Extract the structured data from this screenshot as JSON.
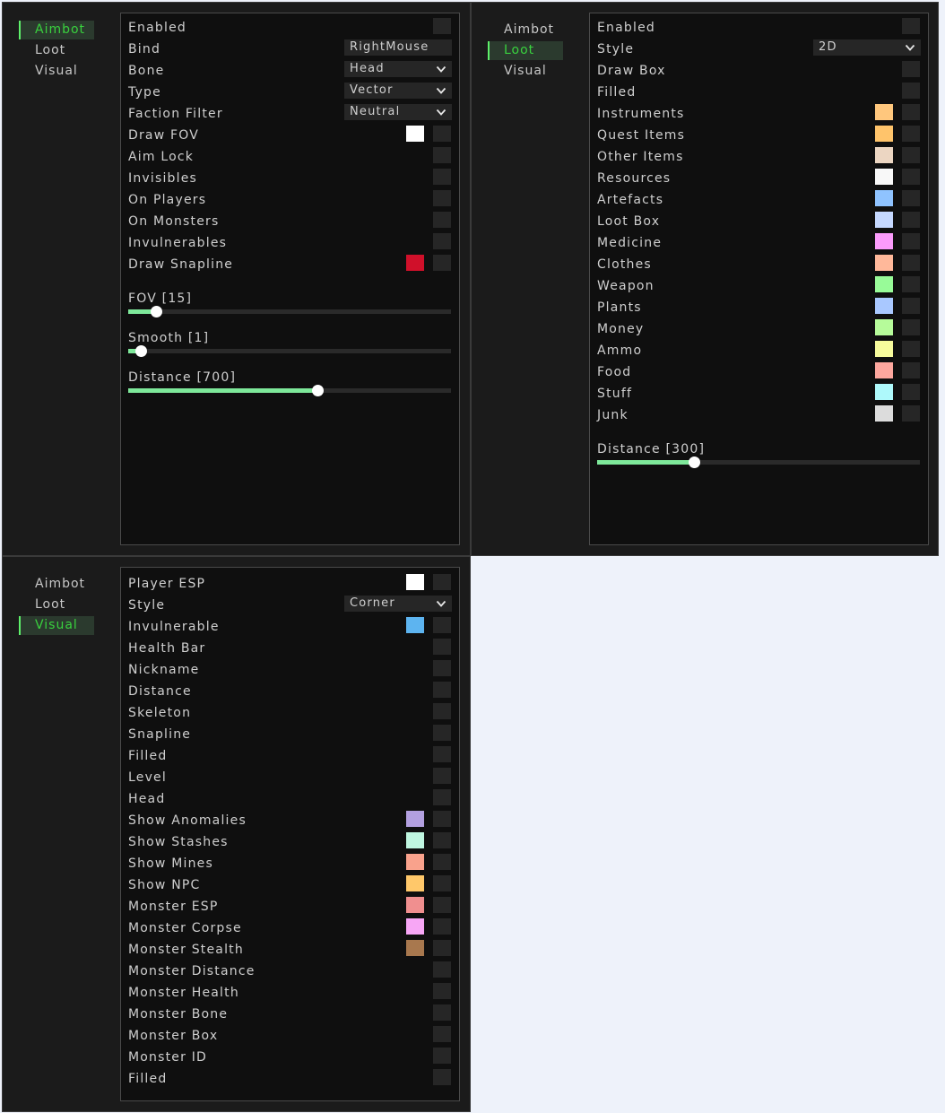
{
  "nav": [
    "Aimbot",
    "Loot",
    "Visual"
  ],
  "windows": [
    {
      "active": 0,
      "rows": [
        {
          "label": "Enabled",
          "checkbox": true
        },
        {
          "label": "Bind",
          "field": "RightMouse"
        },
        {
          "label": "Bone",
          "dropdown": "Head"
        },
        {
          "label": "Type",
          "dropdown": "Vector"
        },
        {
          "label": "Faction Filter",
          "dropdown": "Neutral"
        },
        {
          "label": "Draw FOV",
          "color": "#ffffff",
          "checkbox": true
        },
        {
          "label": "Aim Lock",
          "checkbox": true
        },
        {
          "label": "Invisibles",
          "checkbox": true
        },
        {
          "label": "On Players",
          "checkbox": true
        },
        {
          "label": "On Monsters",
          "checkbox": true
        },
        {
          "label": "Invulnerables",
          "checkbox": true
        },
        {
          "label": "Draw Snapline",
          "color": "#d0102a",
          "checkbox": true
        }
      ],
      "sliders": [
        {
          "label": "FOV [15]",
          "fraction": 0.085
        },
        {
          "label": "Smooth [1]",
          "fraction": 0.04
        },
        {
          "label": "Distance [700]",
          "fraction": 0.585
        }
      ]
    },
    {
      "active": 1,
      "rows": [
        {
          "label": "Enabled",
          "checkbox": true
        },
        {
          "label": "Style",
          "dropdown": "2D"
        },
        {
          "label": "Draw Box",
          "checkbox": true
        },
        {
          "label": "Filled",
          "checkbox": true
        },
        {
          "label": "Instruments",
          "color": "#ffc77d",
          "checkbox": true
        },
        {
          "label": "Quest Items",
          "color": "#ffc46b",
          "checkbox": true
        },
        {
          "label": "Other Items",
          "color": "#ecd6c2",
          "checkbox": true
        },
        {
          "label": "Resources",
          "color": "#f8f8f8",
          "checkbox": true
        },
        {
          "label": "Artefacts",
          "color": "#8fc3ff",
          "checkbox": true
        },
        {
          "label": "Loot Box",
          "color": "#c5d8ff",
          "checkbox": true
        },
        {
          "label": "Medicine",
          "color": "#fb9bfb",
          "checkbox": true
        },
        {
          "label": "Clothes",
          "color": "#ffb89a",
          "checkbox": true
        },
        {
          "label": "Weapon",
          "color": "#98fb98",
          "checkbox": true
        },
        {
          "label": "Plants",
          "color": "#a9c8ff",
          "checkbox": true
        },
        {
          "label": "Money",
          "color": "#b6fb9a",
          "checkbox": true
        },
        {
          "label": "Ammo",
          "color": "#f7fb9c",
          "checkbox": true
        },
        {
          "label": "Food",
          "color": "#fda79e",
          "checkbox": true
        },
        {
          "label": "Stuff",
          "color": "#aef9fb",
          "checkbox": true
        },
        {
          "label": "Junk",
          "color": "#dcdcdc",
          "checkbox": true
        }
      ],
      "sliders": [
        {
          "label": "Distance [300]",
          "fraction": 0.3
        }
      ]
    },
    {
      "active": 2,
      "rows": [
        {
          "label": "Player ESP",
          "color": "#ffffff",
          "checkbox": true
        },
        {
          "label": "Style",
          "dropdown": "Corner"
        },
        {
          "label": "Invulnerable",
          "color": "#5db4f0",
          "checkbox": true
        },
        {
          "label": "Health Bar",
          "checkbox": true
        },
        {
          "label": "Nickname",
          "checkbox": true
        },
        {
          "label": "Distance",
          "checkbox": true
        },
        {
          "label": "Skeleton",
          "checkbox": true
        },
        {
          "label": "Snapline",
          "checkbox": true
        },
        {
          "label": "Filled",
          "checkbox": true
        },
        {
          "label": "Level",
          "checkbox": true
        },
        {
          "label": "Head",
          "checkbox": true
        },
        {
          "label": "Show Anomalies",
          "color": "#b3a0e0",
          "checkbox": true
        },
        {
          "label": "Show Stashes",
          "color": "#bff6e0",
          "checkbox": true
        },
        {
          "label": "Show Mines",
          "color": "#f9a28c",
          "checkbox": true
        },
        {
          "label": "Show NPC",
          "color": "#ffc86a",
          "checkbox": true
        },
        {
          "label": "Monster ESP",
          "color": "#f08f8f",
          "checkbox": true
        },
        {
          "label": "Monster Corpse",
          "color": "#f7a6f5",
          "checkbox": true
        },
        {
          "label": "Monster Stealth",
          "color": "#a8784e",
          "checkbox": true
        },
        {
          "label": "Monster Distance",
          "checkbox": true
        },
        {
          "label": "Monster Health",
          "checkbox": true
        },
        {
          "label": "Monster Bone",
          "checkbox": true
        },
        {
          "label": "Monster Box",
          "checkbox": true
        },
        {
          "label": "Monster ID",
          "checkbox": true
        },
        {
          "label": "Filled",
          "checkbox": true
        }
      ],
      "sliders": []
    }
  ]
}
